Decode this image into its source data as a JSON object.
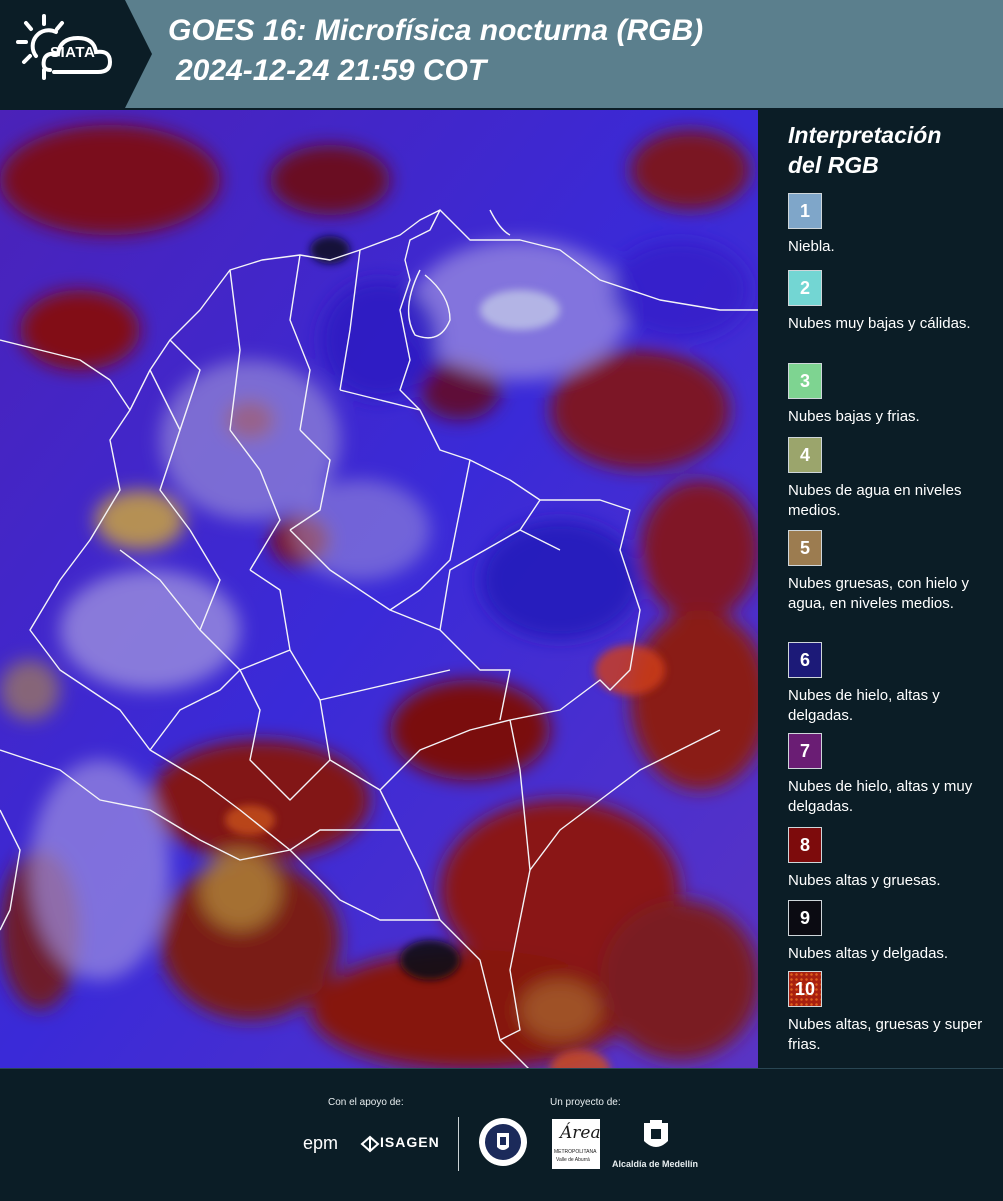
{
  "header": {
    "logo": "SIATA",
    "title_line1": "GOES 16: Microfísica nocturna (RGB)",
    "title_line2": "2024-12-24 21:59 COT"
  },
  "legend": {
    "title_line1": "Interpretación",
    "title_line2": "del RGB",
    "items": [
      {
        "n": "1",
        "label": "Niebla.",
        "color": "#7fa6c9"
      },
      {
        "n": "2",
        "label": "Nubes muy bajas y cálidas.",
        "color": "#73d6d3"
      },
      {
        "n": "3",
        "label": "Nubes bajas y frias.",
        "color": "#7ed491"
      },
      {
        "n": "4",
        "label": "Nubes de agua en niveles medios.",
        "color": "#9ba56c"
      },
      {
        "n": "5",
        "label": "Nubes gruesas, con hielo y agua, en niveles medios.",
        "color": "#9c7c50"
      },
      {
        "n": "6",
        "label": "Nubes de hielo, altas y delgadas.",
        "color": "#1c1a78"
      },
      {
        "n": "7",
        "label": "Nubes de hielo, altas y muy delgadas.",
        "color": "#6a1d74"
      },
      {
        "n": "8",
        "label": "Nubes altas y gruesas.",
        "color": "#7d0b0c"
      },
      {
        "n": "9",
        "label": "Nubes altas y delgadas.",
        "color": "#0b0b12"
      },
      {
        "n": "10",
        "label": "Nubes altas, gruesas y super frias.",
        "color": "#a8200f"
      }
    ]
  },
  "footer": {
    "support_label": "Con el apoyo de:",
    "project_label": "Un proyecto de:",
    "sponsor1": "epm",
    "sponsor2": "ISAGEN",
    "partner1": "Área Metropolitana Valle de Aburrá",
    "partner1_text": "Área",
    "partner1_sub": "METROPOLITANA",
    "partner1_sub2": "Valle de Aburrá",
    "partner2": "Alcaldía de Medellín"
  }
}
